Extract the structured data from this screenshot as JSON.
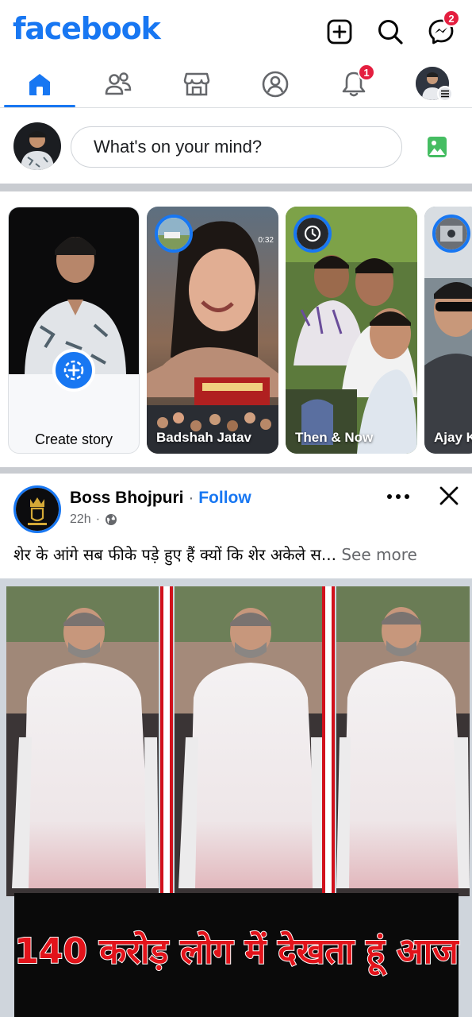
{
  "header": {
    "logo": "facebook",
    "messenger_badge": "2"
  },
  "nav": {
    "tabs": [
      {
        "name": "home",
        "active": true
      },
      {
        "name": "friends"
      },
      {
        "name": "marketplace"
      },
      {
        "name": "profile"
      },
      {
        "name": "notifications",
        "badge": "1"
      },
      {
        "name": "menu"
      }
    ]
  },
  "composer": {
    "placeholder": "What's on your mind?"
  },
  "stories": {
    "create_label": "Create story",
    "items": [
      {
        "label": "Badshah Jatav",
        "duration": "0:32"
      },
      {
        "label": "Then & Now"
      },
      {
        "label": "Ajay K"
      }
    ]
  },
  "post": {
    "page_name": "Boss Bhojpuri",
    "separator": "·",
    "follow_label": "Follow",
    "time": "22h",
    "text": "शेर के आंगे सब फीके पड़े हुए हैं क्यों कि शेर अकेले स...",
    "see_more": "See more",
    "headline": "140 करोड़ लोग में देखता हूं आज"
  },
  "colors": {
    "brand": "#1877f2",
    "badge": "#e41e3f",
    "headline_red": "#e2131a"
  }
}
